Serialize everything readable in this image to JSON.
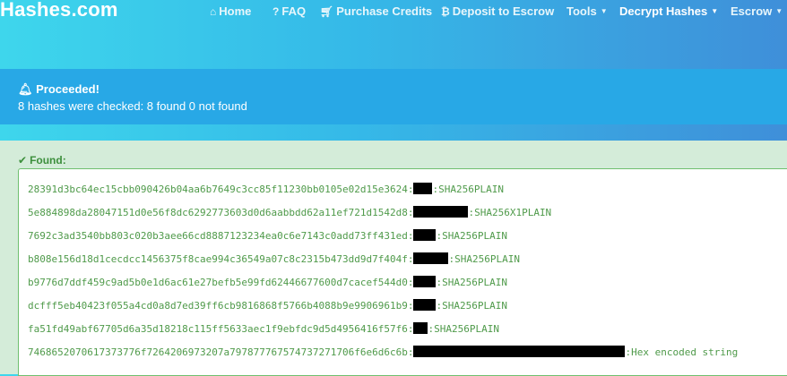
{
  "navbar": {
    "brand": "Hashes.com",
    "items": [
      {
        "label": "Home",
        "icon": "home-icon"
      },
      {
        "label": "FAQ",
        "icon": "question-icon"
      },
      {
        "label": "Purchase Credits",
        "icon": "cart-icon"
      },
      {
        "label": "Deposit to Escrow",
        "icon": "bitcoin-icon"
      },
      {
        "label": "Tools",
        "icon": "caret-down-icon"
      },
      {
        "label": "Decrypt Hashes",
        "icon": "caret-down-icon"
      },
      {
        "label": "Escrow",
        "icon": "caret-down-icon"
      }
    ]
  },
  "info_alert": {
    "title": "Proceeded!",
    "text": "8 hashes were checked: 8 found 0 not found"
  },
  "found": {
    "label": "Found:",
    "rows": [
      {
        "hash": "28391d3bc64ec15cbb090426b04aa6b7649c3cc85f11230bb0105e02d15e3624:",
        "algo": ":SHA256PLAIN"
      },
      {
        "hash": "5e884898da28047151d0e56f8dc6292773603d0d6aabbdd62a11ef721d1542d8:",
        "algo": ":SHA256X1PLAIN"
      },
      {
        "hash": "7692c3ad3540bb803c020b3aee66cd8887123234ea0c6e7143c0add73ff431ed:",
        "algo": ":SHA256PLAIN"
      },
      {
        "hash": "b808e156d18d1cecdcc1456375f8cae994c36549a07c8c2315b473dd9d7f404f:",
        "algo": ":SHA256PLAIN"
      },
      {
        "hash": "b9776d7ddf459c9ad5b0e1d6ac61e27befb5e99fd62446677600d7cacef544d0:",
        "algo": ":SHA256PLAIN"
      },
      {
        "hash": "dcfff5eb40423f055a4cd0a8d7ed39ff6cb9816868f5766b4088b9e9906961b9:",
        "algo": ":SHA256PLAIN"
      },
      {
        "hash": "fa51fd49abf67705d6a35d18218c115ff5633aec1f9ebfdc9d5d4956416f57f6:",
        "algo": ":SHA256PLAIN"
      },
      {
        "hash": "7468652070617373776f7264206973207a797877767574737271706f6e6d6c6b:",
        "algo": ":Hex encoded string"
      }
    ]
  }
}
